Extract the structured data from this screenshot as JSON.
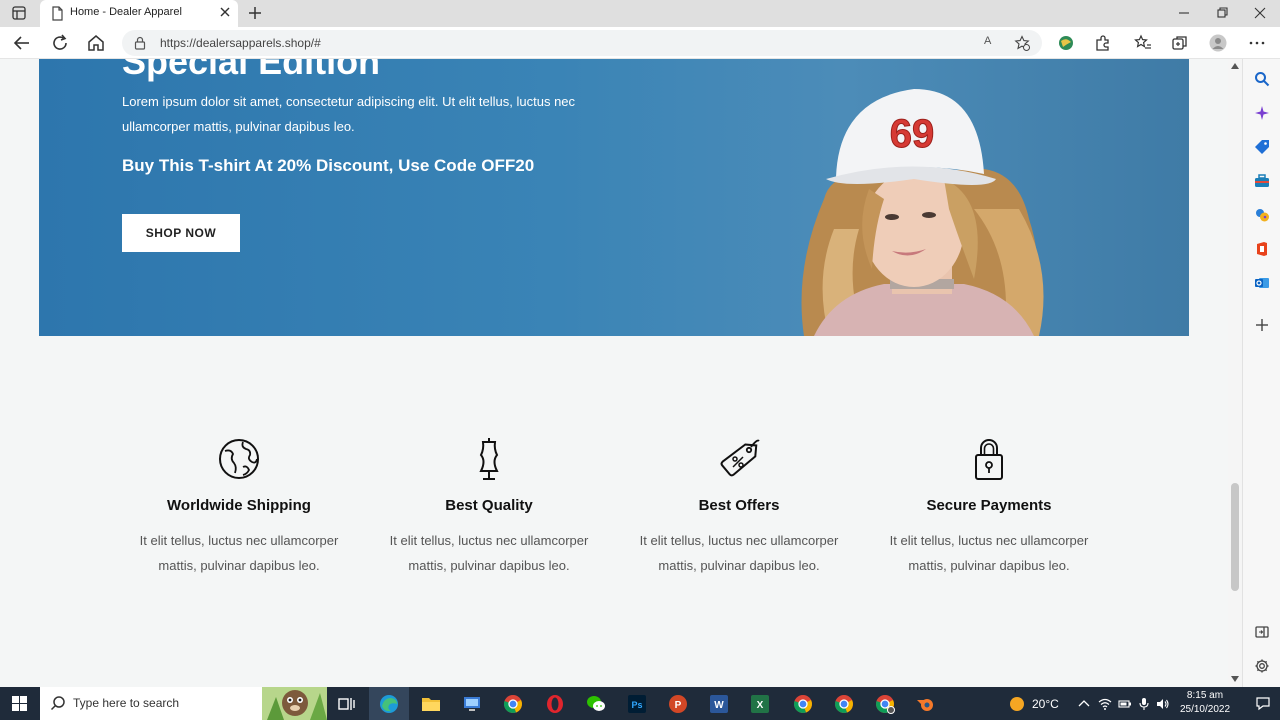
{
  "browser": {
    "tab_title": "Home - Dealer Apparel",
    "url": "https://dealersapparels.shop/#",
    "read_aloud_label": "A"
  },
  "hero": {
    "title": "Special Edition",
    "description": "Lorem ipsum dolor sit amet, consectetur adipiscing elit. Ut elit tellus, luctus nec ullamcorper mattis, pulvinar dapibus leo.",
    "promo": "Buy This T-shirt At 20% Discount, Use Code OFF20",
    "button_label": "SHOP NOW",
    "cap_number": "69"
  },
  "features": [
    {
      "title": "Worldwide Shipping",
      "text": "It elit tellus, luctus nec ullamcorper mattis, pulvinar dapibus leo.",
      "icon": "globe-icon"
    },
    {
      "title": "Best Quality",
      "text": "It elit tellus, luctus nec ullamcorper mattis, pulvinar dapibus leo.",
      "icon": "mannequin-icon"
    },
    {
      "title": "Best Offers",
      "text": "It elit tellus, luctus nec ullamcorper mattis, pulvinar dapibus leo.",
      "icon": "price-tag-icon"
    },
    {
      "title": "Secure Payments",
      "text": "It elit tellus, luctus nec ullamcorper mattis, pulvinar dapibus leo.",
      "icon": "padlock-icon"
    }
  ],
  "taskbar": {
    "search_placeholder": "Type here to search",
    "temperature": "20°C",
    "time": "8:15 am",
    "date": "25/10/2022"
  },
  "colors": {
    "hero_blue": "#2d76ad",
    "page_bg": "#f4f6f6",
    "taskbar_bg": "#1f2b3a"
  }
}
